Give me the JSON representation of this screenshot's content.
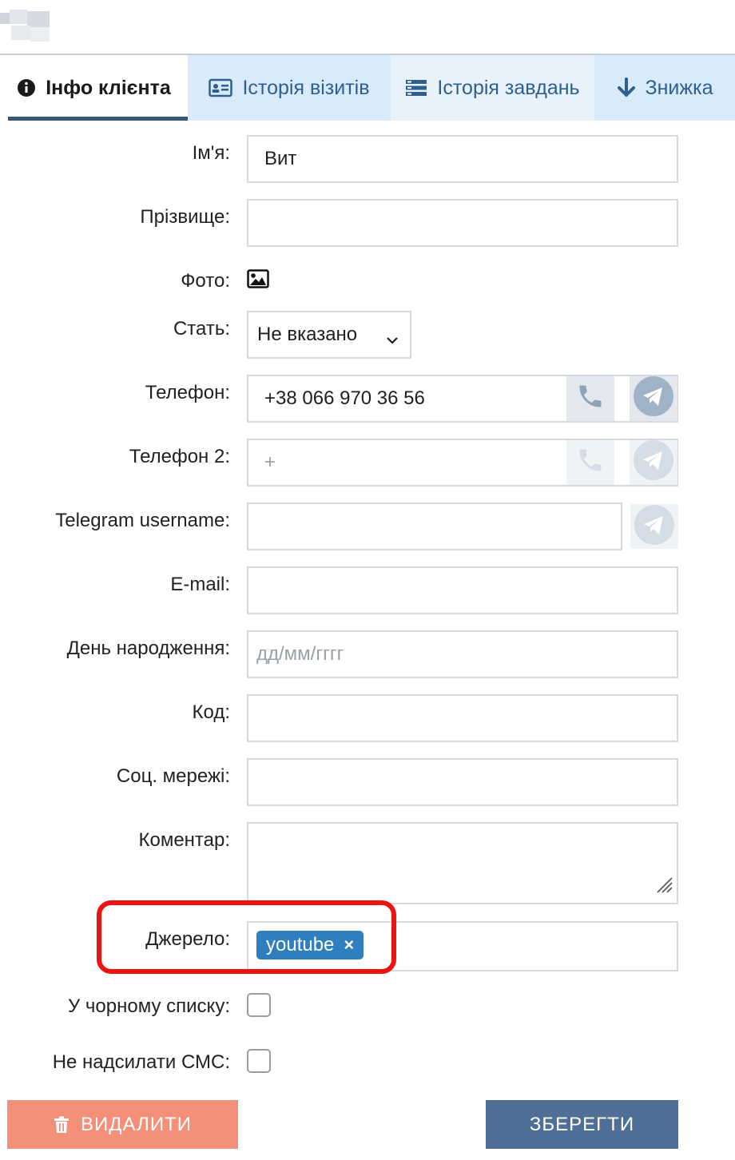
{
  "tabs": [
    {
      "label": "Інфо клієнта",
      "icon": "info-circle-icon"
    },
    {
      "label": "Історія візитів",
      "icon": "id-card-icon"
    },
    {
      "label": "Історія завдань",
      "icon": "tasks-list-icon"
    },
    {
      "label": "Знижка",
      "icon": "arrow-down-icon"
    }
  ],
  "form": {
    "name": {
      "label": "Ім'я:",
      "value": "Вит"
    },
    "surname": {
      "label": "Прізвище:",
      "value": ""
    },
    "photo": {
      "label": "Фото:",
      "icon": "image-icon"
    },
    "gender": {
      "label": "Стать:",
      "value": "Не вказано"
    },
    "phone": {
      "label": "Телефон:",
      "value": "+38 066 970 36 56"
    },
    "phone2": {
      "label": "Телефон 2:",
      "placeholder": "+"
    },
    "telegram": {
      "label": "Telegram username:",
      "value": ""
    },
    "email": {
      "label": "E-mail:",
      "value": ""
    },
    "birthday": {
      "label": "День народження:",
      "placeholder": "дд/мм/гггг"
    },
    "code": {
      "label": "Код:",
      "value": ""
    },
    "social": {
      "label": "Соц. мережі:",
      "value": ""
    },
    "comment": {
      "label": "Коментар:",
      "value": ""
    },
    "source": {
      "label": "Джерело:",
      "tag": "youtube",
      "tag_remove": "×"
    },
    "blacklist": {
      "label": "У чорному списку:",
      "checked": false
    },
    "no_sms": {
      "label": "Не надсилати СМС:",
      "checked": false
    }
  },
  "actions": {
    "delete_label": "ВИДАЛИТИ",
    "save_label": "ЗБЕРЕГТИ"
  },
  "colors": {
    "accent": "#36577d",
    "tab_bg": "#d9ebfa",
    "tag": "#2f7fbf",
    "delete": "#f4907a",
    "save": "#4f6f97",
    "highlight": "#ee1212"
  }
}
